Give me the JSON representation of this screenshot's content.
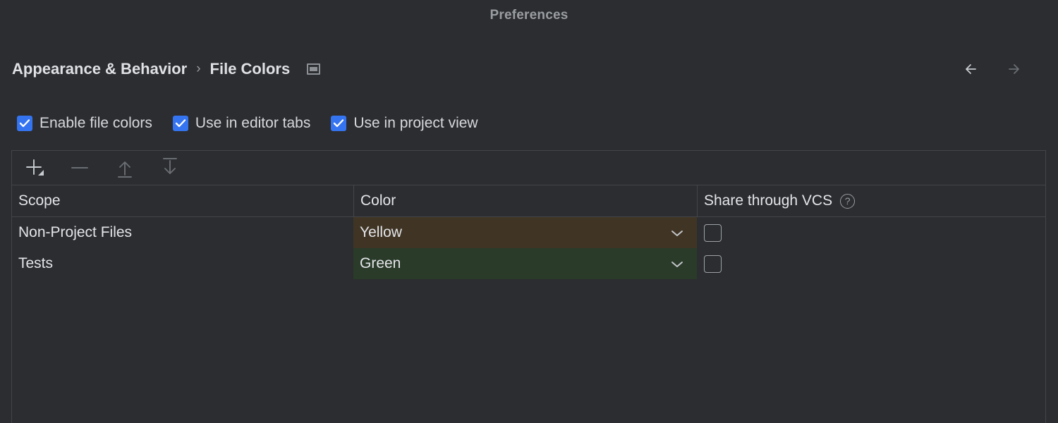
{
  "window": {
    "title": "Preferences"
  },
  "breadcrumb": {
    "items": [
      "Appearance & Behavior",
      "File Colors"
    ],
    "separator": "›",
    "panel_icon": "panel-window-icon"
  },
  "navigation": {
    "back_icon": "arrow-left-icon",
    "forward_icon": "arrow-right-icon",
    "back_enabled": true,
    "forward_enabled": false
  },
  "options": [
    {
      "label": "Enable file colors",
      "checked": true
    },
    {
      "label": "Use in editor tabs",
      "checked": true
    },
    {
      "label": "Use in project view",
      "checked": true
    }
  ],
  "toolbar": {
    "buttons": [
      {
        "name": "add-button",
        "icon": "plus-icon",
        "enabled": true,
        "has_dropdown": true
      },
      {
        "name": "remove-button",
        "icon": "minus-icon",
        "enabled": false,
        "has_dropdown": false
      },
      {
        "name": "move-up-button",
        "icon": "arrow-up-icon",
        "enabled": false,
        "has_dropdown": false
      },
      {
        "name": "move-down-button",
        "icon": "arrow-down-icon",
        "enabled": false,
        "has_dropdown": false
      }
    ]
  },
  "table": {
    "columns": [
      {
        "key": "scope",
        "label": "Scope"
      },
      {
        "key": "color",
        "label": "Color"
      },
      {
        "key": "vcs",
        "label": "Share through VCS",
        "help_icon": "question-mark-icon"
      }
    ],
    "rows": [
      {
        "scope": "Non-Project Files",
        "color": "Yellow",
        "color_bg": "#403525",
        "shared": false,
        "dropdown_icon": "chevron-down-icon"
      },
      {
        "scope": "Tests",
        "color": "Green",
        "color_bg": "#2a3b2a",
        "shared": false,
        "dropdown_icon": "chevron-down-icon"
      }
    ]
  },
  "colors": {
    "background": "#2b2d30",
    "border": "#43454a",
    "accent": "#3574f0",
    "text": "#e3e5e9",
    "text_muted": "#9a9da1",
    "icon_enabled": "#c8cbd0",
    "icon_disabled": "#6a6e73"
  }
}
